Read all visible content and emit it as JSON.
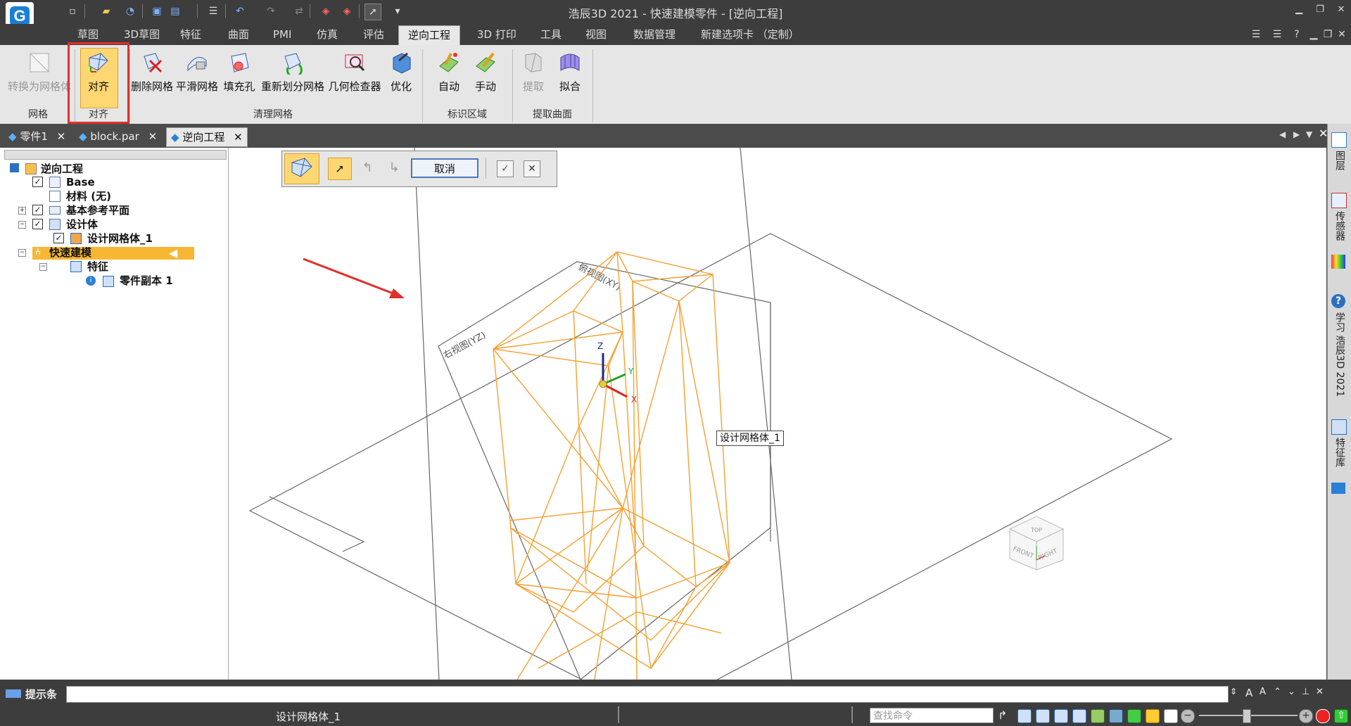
{
  "window": {
    "title": "浩辰3D 2021 - 快速建模零件 - [逆向工程]",
    "minimize": "▁",
    "restore": "❐",
    "close": "✕"
  },
  "ribbon_tabs": [
    "草图",
    "3D草图",
    "特征",
    "曲面",
    "PMI",
    "仿真",
    "评估",
    "逆向工程",
    "3D 打印",
    "工具",
    "视图",
    "数据管理",
    "新建选项卡 （定制）"
  ],
  "ribbon_tab_active": "逆向工程",
  "ribbon": {
    "mesh_group": {
      "label": "网格",
      "convert_button": "转换为网格体"
    },
    "align_group": {
      "label": "对齐",
      "align_button": "对齐"
    },
    "clean_group": {
      "label": "清理网格",
      "buttons": [
        "删除网格",
        "平滑网格",
        "填充孔",
        "重新划分网格",
        "几何检查器",
        "优化"
      ]
    },
    "mark_group": {
      "label": "标识区域",
      "buttons": [
        "自动",
        "手动"
      ]
    },
    "extract_group": {
      "label": "提取曲面",
      "buttons": [
        "提取",
        "拟合"
      ]
    }
  },
  "doc_tabs": [
    {
      "label": "零件1",
      "close": "✕"
    },
    {
      "label": "block.par",
      "close": "✕"
    },
    {
      "label": "逆向工程",
      "close": "✕",
      "active": true
    }
  ],
  "tree": {
    "root": "逆向工程",
    "base": "Base",
    "material": "材料 (无)",
    "ref_planes": "基本参考平面",
    "design_body": "设计体",
    "mesh_body": "设计网格体_1",
    "quick_model": "快速建模",
    "features": "特征",
    "part_copy": "零件副本 1"
  },
  "command_bar": {
    "cancel": "取消",
    "ok": "✓",
    "close": "✕"
  },
  "viewport": {
    "plane_yz": "右视图(YZ)",
    "plane_xy": "俯视图(XY)",
    "mesh_tooltip": "设计网格体_1",
    "axis_x": "X",
    "axis_y": "Y",
    "axis_z": "Z",
    "viewcube_front": "FRONT",
    "viewcube_right": "RIGHT",
    "viewcube_top": "TOP"
  },
  "right_bar": [
    "图层",
    "传感器",
    "学习 浩辰3D 2021",
    "特征库"
  ],
  "prompt_bar": {
    "label": "提示条"
  },
  "status_bar": {
    "selection": "设计网格体_1",
    "find_placeholder": "查找命令"
  },
  "colors": {
    "mesh_orange": "#f5a030",
    "highlight_red": "#e0302a",
    "active_tab_bg": "#e8e8e8",
    "dark_chrome": "#3d3d3d"
  }
}
